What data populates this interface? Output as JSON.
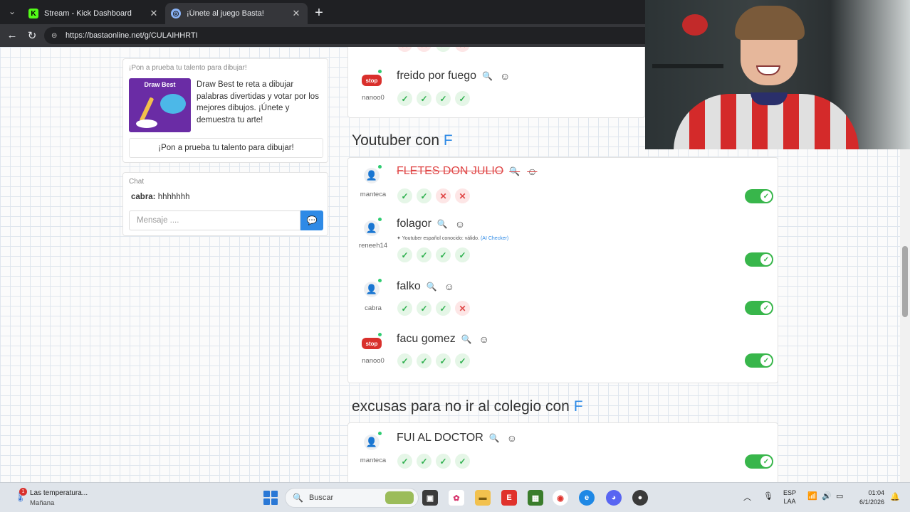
{
  "browser": {
    "tabs": [
      {
        "title": "Stream - Kick Dashboard",
        "icon": "kick-icon",
        "color": "#53fc18"
      },
      {
        "title": "¡Únete al juego Basta!",
        "icon": "globe-icon",
        "color": "#8ab4f8"
      }
    ],
    "url": "https://bastaonline.net/g/CULAIHHRTI"
  },
  "sidebar": {
    "promo": {
      "heading": "¡Pon a prueba tu talento para dibujar!",
      "image_label": "Draw Best",
      "text": "Draw Best te reta a dibujar palabras divertidas y votar por los mejores dibujos. ¡Únete y demuestra tu arte!",
      "button": "¡Pon a prueba tu talento para dibujar!"
    },
    "chat": {
      "heading": "Chat",
      "messages": [
        {
          "user": "cabra:",
          "text": "hhhhhhh"
        }
      ],
      "input_placeholder": "Mensaje ...."
    }
  },
  "top_answer": {
    "text": "freido por fuego",
    "user": "nanoo0",
    "avatar": "stop",
    "votes": [
      "ok",
      "ok",
      "ok",
      "ok"
    ]
  },
  "categories": [
    {
      "title": "Youtuber con",
      "letter": "F",
      "answers": [
        {
          "text": "FLETES DON JULIO",
          "user": "manteca",
          "avatar": "user",
          "strike": true,
          "votes": [
            "ok",
            "ok",
            "no",
            "no"
          ],
          "toggle": true
        },
        {
          "text": "folagor",
          "user": "reneeh14",
          "avatar": "user-star",
          "strike": false,
          "note": "Youtuber español conocido: válido.",
          "note_checker": "(AI Checker)",
          "votes": [
            "ok",
            "ok",
            "ok",
            "ok"
          ],
          "toggle": true
        },
        {
          "text": "falko",
          "user": "cabra",
          "avatar": "user",
          "strike": false,
          "votes": [
            "ok",
            "ok",
            "ok",
            "no"
          ],
          "toggle": true
        },
        {
          "text": "facu gomez",
          "user": "nanoo0",
          "avatar": "stop",
          "strike": false,
          "votes": [
            "ok",
            "ok",
            "ok",
            "ok"
          ],
          "toggle": true
        }
      ]
    },
    {
      "title": "excusas para no ir al colegio con",
      "letter": "F",
      "answers": [
        {
          "text": "FUI AL DOCTOR",
          "user": "manteca",
          "avatar": "user",
          "strike": false,
          "votes": [
            "ok",
            "ok",
            "ok",
            "ok"
          ],
          "toggle": true
        }
      ]
    }
  ],
  "taskbar": {
    "weather_title": "Las temperatura...",
    "weather_sub": "Mañana",
    "weather_badge": "1",
    "search_placeholder": "Buscar",
    "lang_top": "ESP",
    "lang_bottom": "LAA",
    "time": "01:04",
    "date": "6/1/2026"
  },
  "colors": {
    "accent": "#2e8ae6",
    "toggle_on": "#38b64b",
    "vote_ok": "#2eb04e",
    "vote_no": "#e04848"
  }
}
